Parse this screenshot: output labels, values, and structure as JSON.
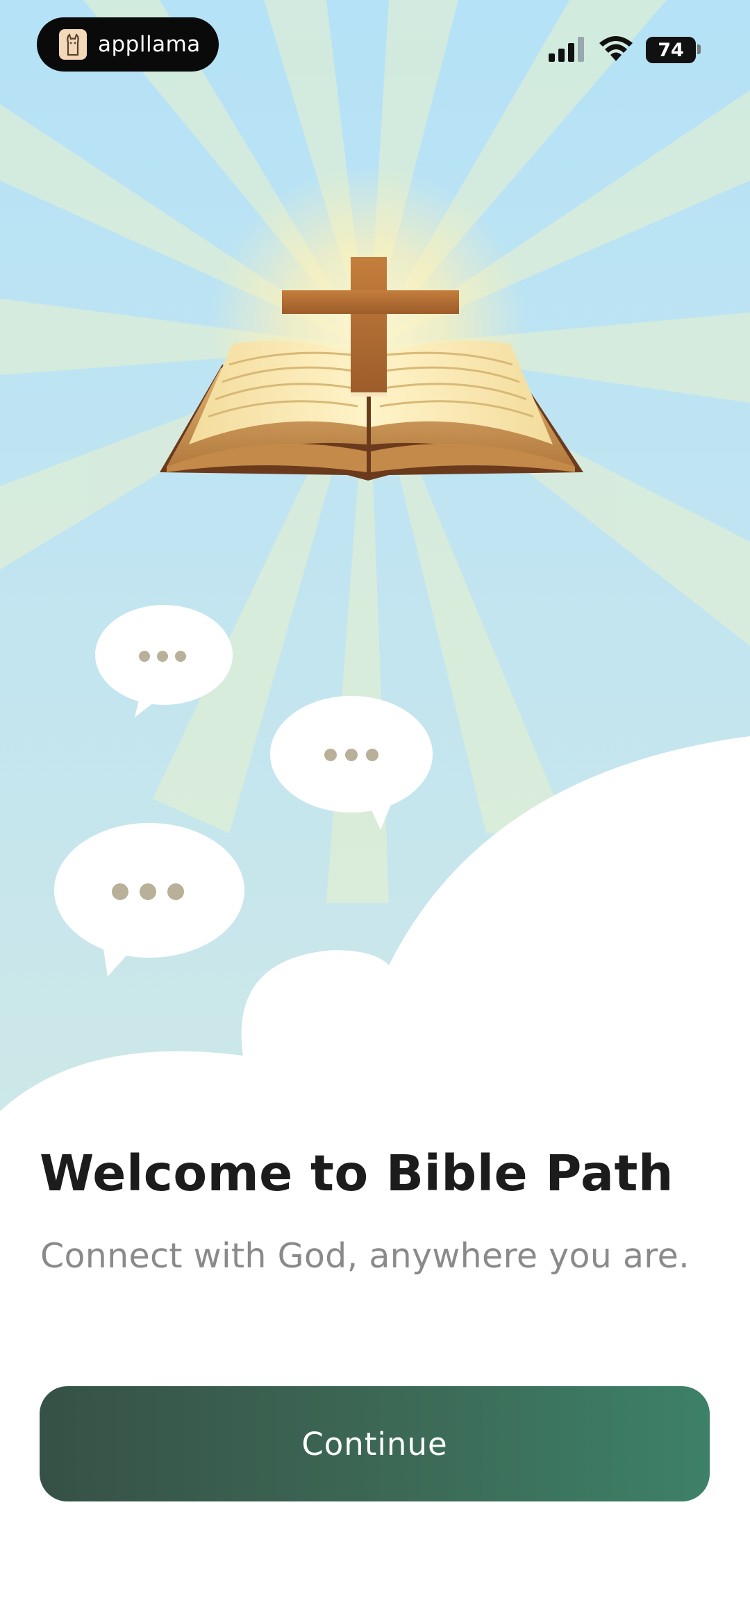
{
  "status_bar": {
    "brand_name": "appllama",
    "brand_icon": "llama-icon",
    "signal_icon": "cellular-signal-icon",
    "wifi_icon": "wifi-icon",
    "battery_level": "74"
  },
  "hero": {
    "illustration": "open-bible-with-cross",
    "bubble_icon": "speech-bubble-ellipsis-icon"
  },
  "welcome": {
    "title": "Welcome to Bible Path",
    "subtitle": "Connect with God, anywhere you are."
  },
  "actions": {
    "continue_label": "Continue"
  },
  "colors": {
    "sky": "#b5e2f7",
    "accent_start": "#365146",
    "accent_end": "#3d8168",
    "title": "#1c1c1c",
    "subtitle": "#8a8a8a"
  }
}
